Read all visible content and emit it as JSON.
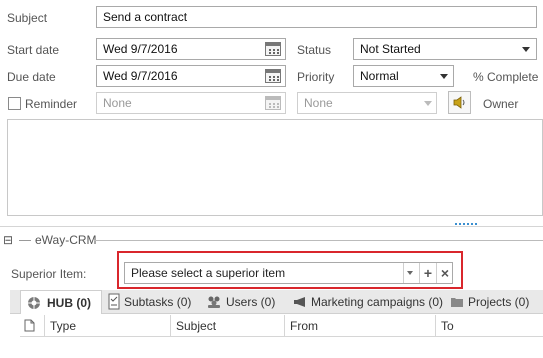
{
  "form": {
    "subject_label": "Subject",
    "subject_value": "Send a contract",
    "start_date_label": "Start date",
    "start_date_value": "Wed 9/7/2016",
    "due_date_label": "Due date",
    "due_date_value": "Wed 9/7/2016",
    "reminder_label": "Reminder",
    "reminder_date_value": "None",
    "reminder_time_value": "None",
    "status_label": "Status",
    "status_value": "Not Started",
    "priority_label": "Priority",
    "priority_value": "Normal",
    "percent_complete_label": "% Complete",
    "owner_label": "Owner"
  },
  "section": {
    "collapse_symbol": "⊟",
    "title": "eWay-CRM"
  },
  "superior": {
    "label": "Superior Item:",
    "placeholder": "Please select a superior item",
    "add_symbol": "+",
    "clear_symbol": "×",
    "highlight_color": "#d9262c"
  },
  "tabs": [
    {
      "label": "HUB (0)",
      "icon": "hub-icon"
    },
    {
      "label": "Subtasks (0)",
      "icon": "subtasks-icon"
    },
    {
      "label": "Users (0)",
      "icon": "users-icon"
    },
    {
      "label": "Marketing campaigns (0)",
      "icon": "megaphone-icon"
    },
    {
      "label": "Projects (0)",
      "icon": "folder-icon"
    }
  ],
  "grid": {
    "columns": [
      "Type",
      "Subject",
      "From",
      "To"
    ]
  }
}
